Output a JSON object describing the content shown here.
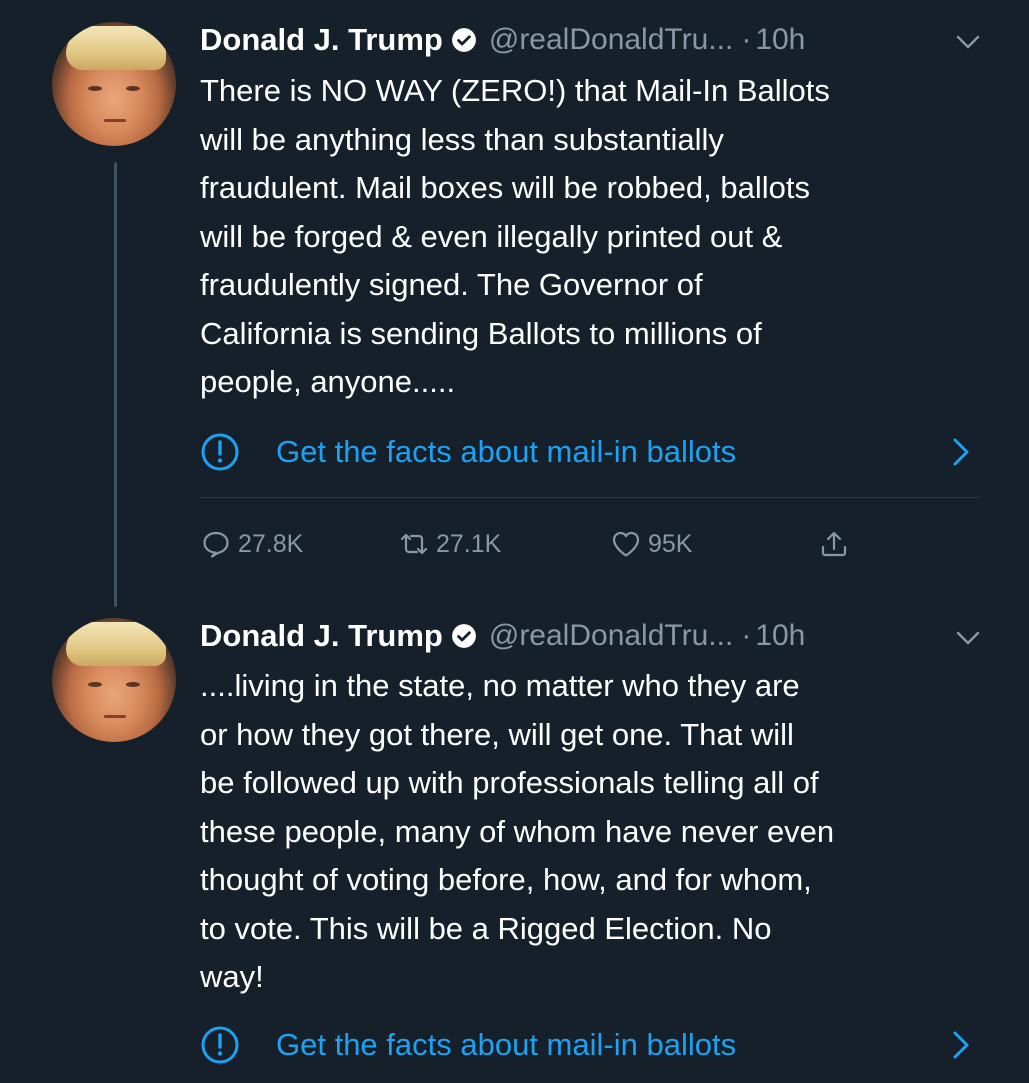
{
  "tweets": [
    {
      "name": "Donald J. Trump",
      "handle": "@realDonaldTru...",
      "separator": "·",
      "time": "10h",
      "lines": [
        "There is NO WAY (ZERO!) that Mail-In Ballots",
        "will be anything less than substantially",
        "fraudulent. Mail boxes will be robbed, ballots",
        "will be forged & even illegally printed out &",
        "fraudulently signed. The Governor of",
        "California is sending Ballots to millions of",
        "people, anyone....."
      ],
      "facts_label": "Get the facts about mail-in ballots",
      "actions": {
        "replies": "27.8K",
        "retweets": "27.1K",
        "likes": "95K"
      }
    },
    {
      "name": "Donald J. Trump",
      "handle": "@realDonaldTru...",
      "separator": "·",
      "time": "10h",
      "lines": [
        "....living in the state, no matter who they are",
        "or how they got there, will get one. That will",
        "be followed up with professionals telling all of",
        "these people, many of whom have never even",
        "thought of voting before, how, and for whom,",
        "to vote. This will be a Rigged Election. No",
        "way!"
      ],
      "facts_label": "Get the facts about mail-in ballots"
    }
  ],
  "colors": {
    "background": "#15202b",
    "link": "#1da1f2",
    "secondary_text": "#8899a6"
  },
  "icons": [
    "verified-badge-icon",
    "chevron-down-icon",
    "info-exclamation-icon",
    "chevron-right-icon",
    "reply-icon",
    "retweet-icon",
    "like-icon",
    "share-icon"
  ]
}
